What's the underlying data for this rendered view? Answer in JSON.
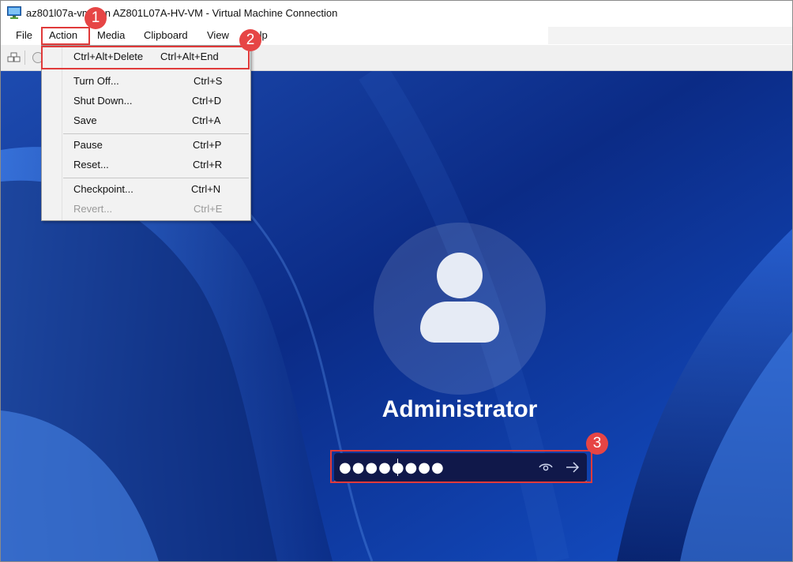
{
  "window": {
    "title": "az801l07a-vm1 on AZ801L07A-HV-VM - Virtual Machine Connection"
  },
  "menubar": {
    "items": [
      "File",
      "Action",
      "Media",
      "Clipboard",
      "View",
      "Help"
    ]
  },
  "action_menu": {
    "items": [
      {
        "label": "Ctrl+Alt+Delete",
        "shortcut": "Ctrl+Alt+End",
        "enabled": true
      },
      {
        "label": "Turn Off...",
        "shortcut": "Ctrl+S",
        "enabled": true
      },
      {
        "label": "Shut Down...",
        "shortcut": "Ctrl+D",
        "enabled": true
      },
      {
        "label": "Save",
        "shortcut": "Ctrl+A",
        "enabled": true
      },
      {
        "label": "Pause",
        "shortcut": "Ctrl+P",
        "enabled": true
      },
      {
        "label": "Reset...",
        "shortcut": "Ctrl+R",
        "enabled": true
      },
      {
        "label": "Checkpoint...",
        "shortcut": "Ctrl+N",
        "enabled": true
      },
      {
        "label": "Revert...",
        "shortcut": "Ctrl+E",
        "enabled": false
      }
    ]
  },
  "login": {
    "username": "Administrator",
    "password_masked": "●●●●●●●●",
    "reveal_icon": "eye-icon",
    "submit_icon": "arrow-right-icon"
  },
  "annotations": {
    "step1": "1",
    "step2": "2",
    "step3": "3",
    "color": "#e03a3a"
  },
  "colors": {
    "wallpaper": "#0d2a7a",
    "menu_background": "#f2f2f2"
  }
}
